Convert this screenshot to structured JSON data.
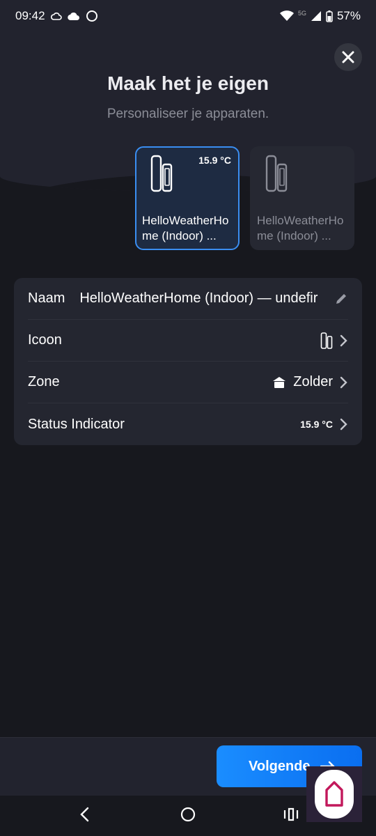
{
  "status_bar": {
    "time": "09:42",
    "network": "5G",
    "battery": "57%",
    "icons": [
      "cloud-outline-icon",
      "cloud-icon",
      "circle-icon",
      "wifi-icon",
      "signal-icon",
      "battery-icon"
    ]
  },
  "header": {
    "title": "Maak het je eigen",
    "subtitle": "Personaliseer je apparaten."
  },
  "devices": [
    {
      "name": "HelloWeatherHome (Indoor) ...",
      "temp": "15.9 °C",
      "selected": true,
      "icon": "sensor-icon"
    },
    {
      "name": "HelloWeatherHome (Indoor) ...",
      "temp": "",
      "selected": false,
      "icon": "sensor-icon"
    }
  ],
  "settings": {
    "name": {
      "label": "Naam",
      "value": "HelloWeatherHome (Indoor) — undefir"
    },
    "icon": {
      "label": "Icoon"
    },
    "zone": {
      "label": "Zone",
      "value": "Zolder"
    },
    "status": {
      "label": "Status Indicator",
      "value": "15.9 °C"
    }
  },
  "footer": {
    "next_label": "Volgende"
  },
  "colors": {
    "accent": "#1a8dff",
    "background": "#17181e",
    "card": "#242630",
    "badge": "#c2185b"
  }
}
